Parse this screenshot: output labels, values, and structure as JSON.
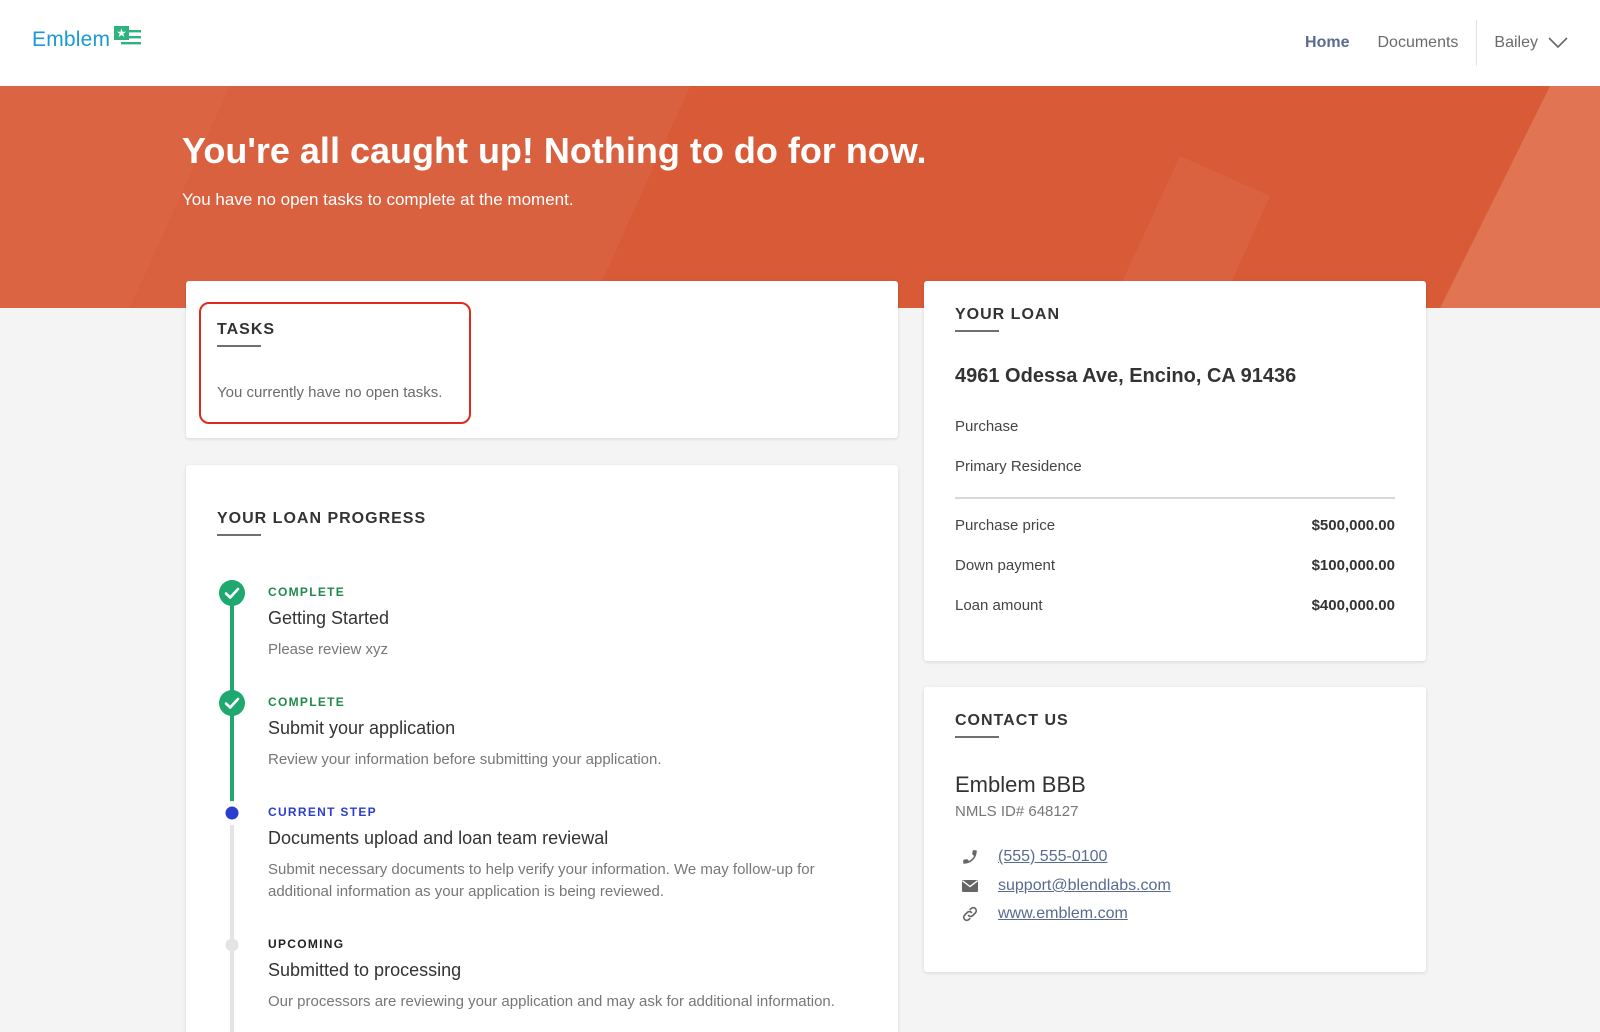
{
  "brand": {
    "name": "Emblem",
    "primary_color": "#1a9ad0",
    "icon_color": "#2db37e"
  },
  "nav": {
    "home": "Home",
    "documents": "Documents",
    "user": "Bailey",
    "user_icon": "chevron-down-icon"
  },
  "hero": {
    "title": "You're all caught up! Nothing to do for now.",
    "subtitle": "You have no open tasks to complete at the moment.",
    "background_color": "#d85a37"
  },
  "tasks": {
    "heading": "TASKS",
    "empty_message": "You currently have no open tasks.",
    "highlight_color": "#e02a1e"
  },
  "progress": {
    "heading": "YOUR LOAN PROGRESS",
    "steps": [
      {
        "status": "COMPLETE",
        "title": "Getting Started",
        "description": "Please review xyz",
        "state": "complete",
        "status_color": "#1f8a4c"
      },
      {
        "status": "COMPLETE",
        "title": "Submit your application",
        "description": "Review your information before submitting your application.",
        "state": "complete",
        "status_color": "#1f8a4c"
      },
      {
        "status": "CURRENT STEP",
        "title": "Documents upload and loan team reviewal",
        "description": "Submit necessary documents to help verify your information. We may follow-up for additional information as your application is being reviewed.",
        "state": "current",
        "status_color": "#2b3fcf"
      },
      {
        "status": "UPCOMING",
        "title": "Submitted to processing",
        "description": "Our processors are reviewing your application and may ask for additional information.",
        "state": "upcoming",
        "status_color": "#222222"
      }
    ]
  },
  "loan": {
    "heading": "YOUR LOAN",
    "address": "4961 Odessa Ave, Encino, CA 91436",
    "purpose": "Purchase",
    "occupancy": "Primary Residence",
    "rows": [
      {
        "label": "Purchase price",
        "value": "$500,000.00"
      },
      {
        "label": "Down payment",
        "value": "$100,000.00"
      },
      {
        "label": "Loan amount",
        "value": "$400,000.00"
      }
    ]
  },
  "contact": {
    "heading": "CONTACT US",
    "name": "Emblem BBB",
    "nmls": "NMLS ID# 648127",
    "phone": "(555) 555-0100",
    "email": "support@blendlabs.com",
    "website": "www.emblem.com",
    "icons": [
      "phone-icon",
      "mail-icon",
      "link-icon"
    ]
  }
}
